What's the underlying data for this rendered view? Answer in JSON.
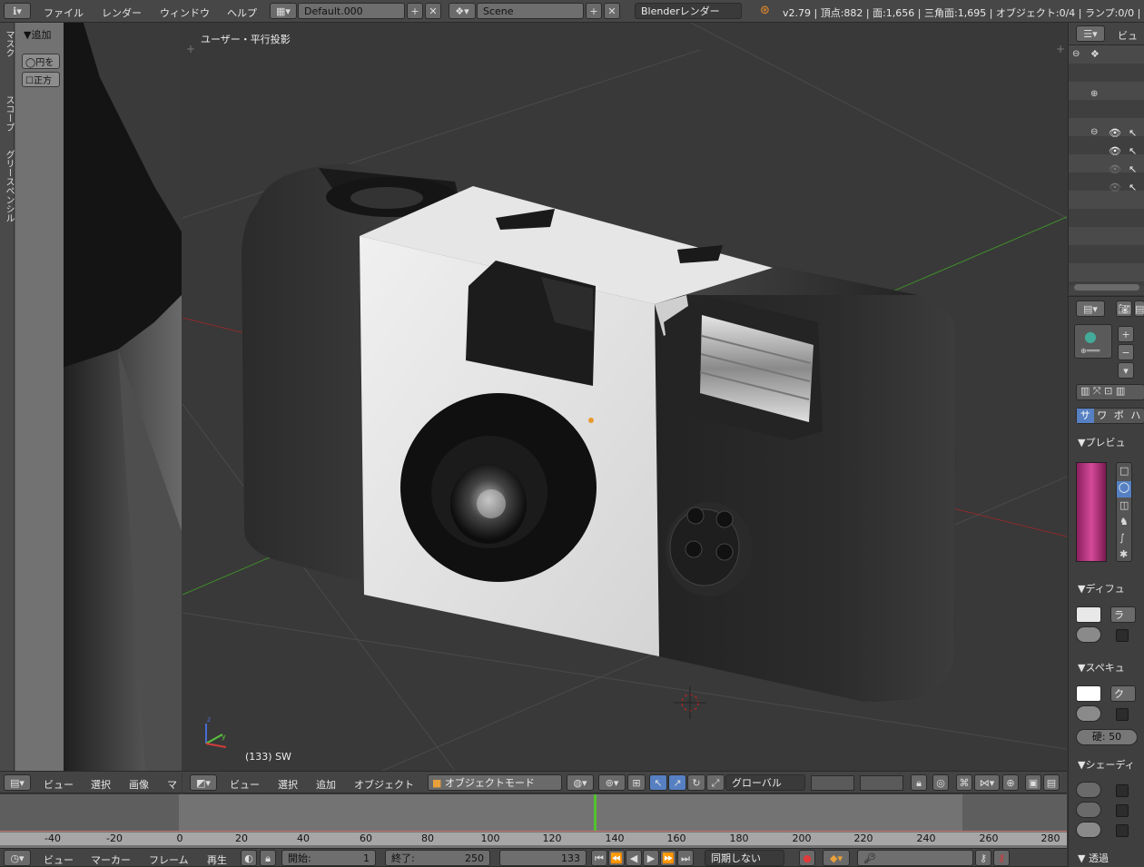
{
  "topbar": {
    "menus": [
      "ファイル",
      "レンダー",
      "ウィンドウ",
      "ヘルプ"
    ],
    "layout": "Default.000",
    "scene": "Scene",
    "engine": "Blenderレンダー",
    "stats": "v2.79 | 頂点:882 | 面:1,656 | 三角面:1,695 | オブジェクト:0/4 | ランプ:0/0 | メ"
  },
  "left_panel": {
    "header": "▼追加",
    "tabs": [
      "マスク",
      "スコープ",
      "グリースペンシル"
    ],
    "options": [
      "円を",
      "正方"
    ],
    "footer_menus": [
      "ビュー",
      "選択",
      "画像",
      "マ"
    ]
  },
  "viewport": {
    "view_label": "ユーザー・平行投影",
    "frame_label": "(133) SW",
    "menus": [
      "ビュー",
      "選択",
      "追加",
      "オブジェクト"
    ],
    "mode": "オブジェクトモード",
    "orientation": "グローバル"
  },
  "timeline": {
    "ticks": [
      "-40",
      "-20",
      "0",
      "20",
      "40",
      "60",
      "80",
      "100",
      "120",
      "140",
      "160",
      "180",
      "200",
      "220",
      "240",
      "260",
      "280"
    ],
    "current_frame": 133,
    "menus": [
      "ビュー",
      "マーカー",
      "フレーム",
      "再生"
    ],
    "start_label": "開始:",
    "start": "1",
    "end_label": "終了:",
    "end": "250",
    "frame": "133",
    "sync": "同期しない"
  },
  "outliner": {
    "header": "ビュー"
  },
  "properties": {
    "tabs": [
      "サ",
      "ワ",
      "ボ",
      "ハ"
    ],
    "preview": "▼プレビュ",
    "diffuse": "▼ディフュ",
    "diffuse_btn": "ラ",
    "specular": "▼スペキュ",
    "specular_btn": "ク",
    "hardness": "硬: 50",
    "shading": "▼シェーディ",
    "transparency": "▼ 透過"
  },
  "colors": {
    "frame_line": "#52c22e",
    "accent_blue": "#5680c2"
  }
}
